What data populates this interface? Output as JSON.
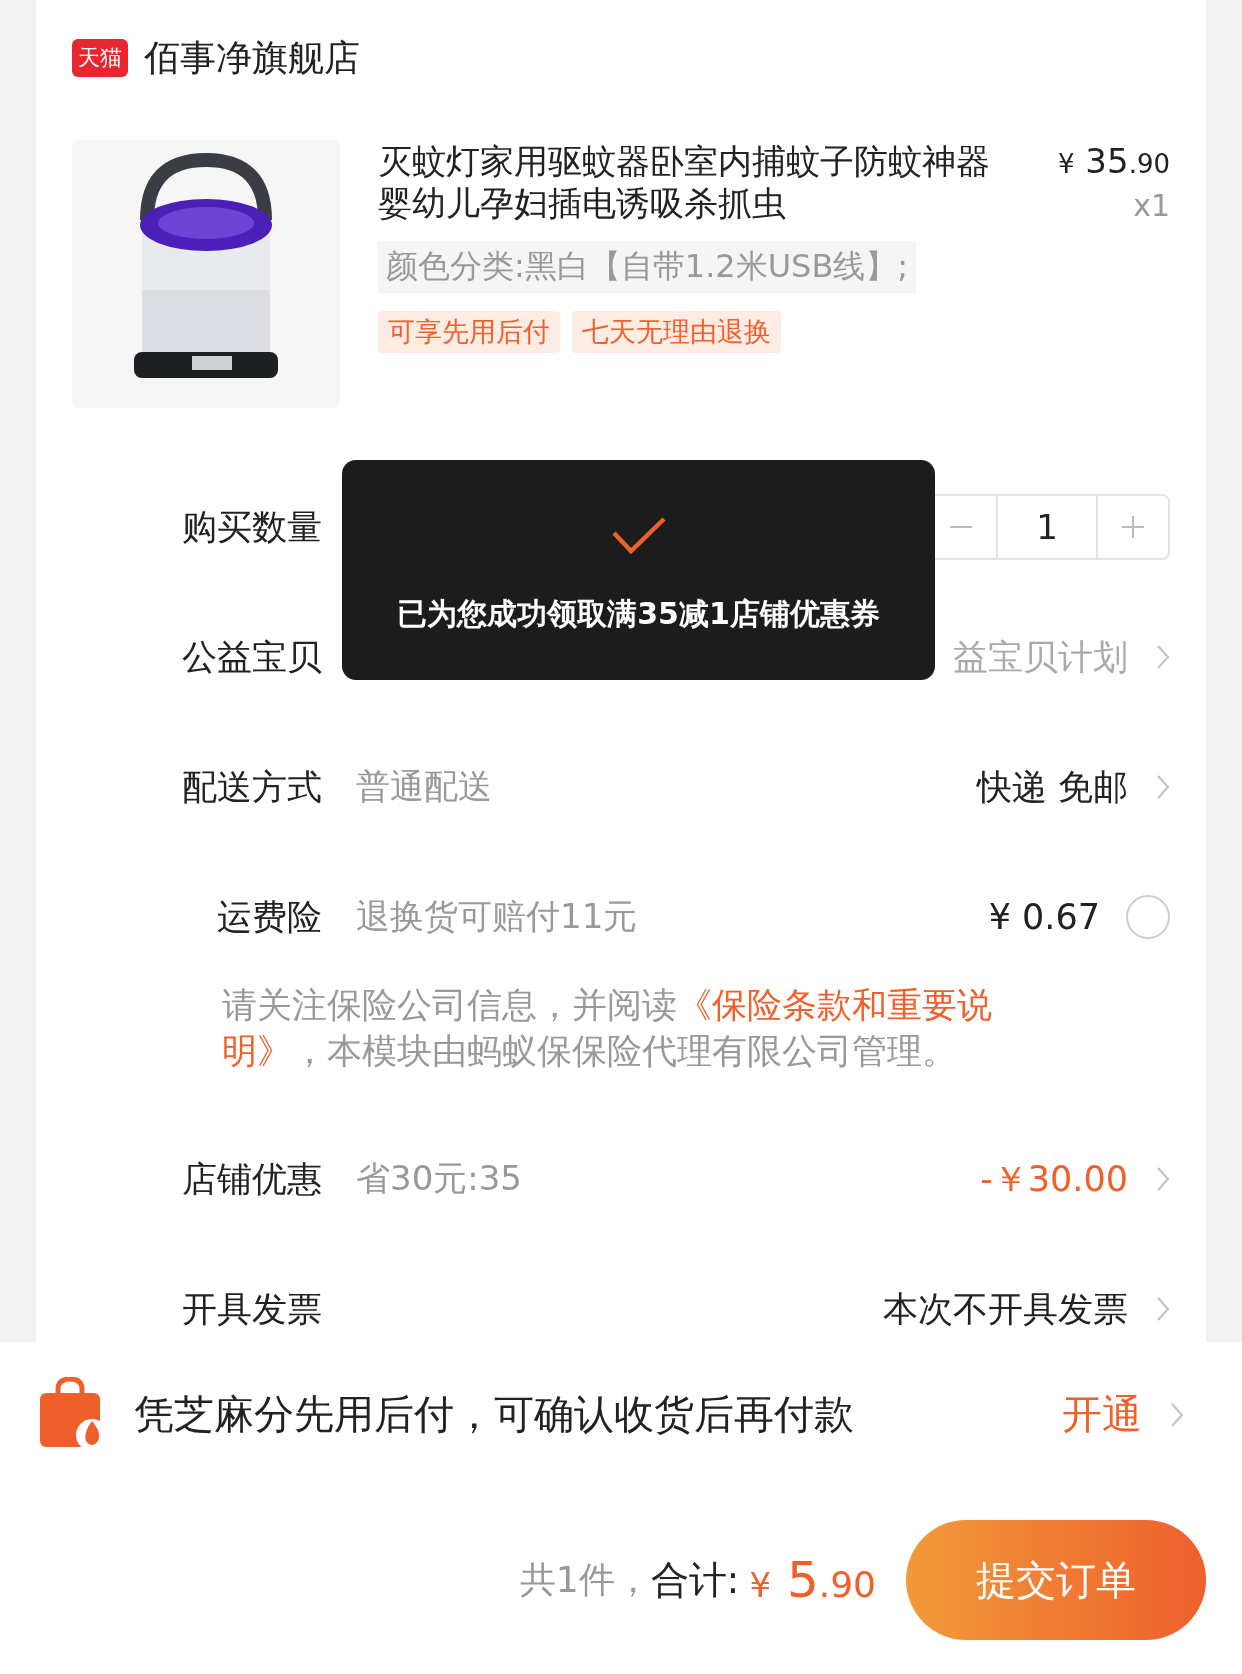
{
  "store": {
    "name": "佰事净旗舰店",
    "badge": "天猫"
  },
  "product": {
    "title": "灭蚊灯家用驱蚊器卧室内捕蚊子防蚊神器婴幼儿孕妇插电诱吸杀抓虫",
    "currency": "¥",
    "price_int": "35",
    "price_dec": ".90",
    "quantity": "x1",
    "sku": "颜色分类:黑白【自带1.2米USB线】;",
    "tags": [
      "可享先用后付",
      "七天无理由退换"
    ]
  },
  "rows": [
    {
      "kind": "stepper",
      "label": "购买数量",
      "value": "1"
    },
    {
      "kind": "info",
      "label": "公益宝贝",
      "value": "益宝贝计划",
      "highlight": false,
      "muted": true
    },
    {
      "kind": "info",
      "label": "配送方式",
      "detail": "普通配送",
      "value": "快递 免邮",
      "highlight": false,
      "muted": false
    },
    {
      "kind": "insurance",
      "label": "运费险",
      "detail": "退换货可赔付11元",
      "value": "¥ 0.67",
      "checked": false
    },
    {
      "kind": "note",
      "before": "请关注保险公司信息，并阅读",
      "link": [
        "《保险条款和重要说",
        "明》"
      ],
      "after": "，本模块由蚂蚁保保险代理有限公司管理。"
    },
    {
      "kind": "info",
      "label": "店铺优惠",
      "detail": "省30元:35",
      "value": "-￥30.00",
      "highlight": true,
      "muted": false
    },
    {
      "kind": "info",
      "label": "开具发票",
      "value": "本次不开具发票",
      "highlight": false,
      "muted": false
    }
  ],
  "toast": {
    "text": "已为您成功领取满35减1店铺优惠券"
  },
  "paylater": {
    "text": "凭芝麻分先用后付，可确认收货后再付款",
    "action": "开通"
  },
  "footer": {
    "count": "共1件，",
    "total_label": "合计:",
    "currency": "¥",
    "amount_int": "5",
    "amount_dec": ".90",
    "submit": "提交订单"
  }
}
